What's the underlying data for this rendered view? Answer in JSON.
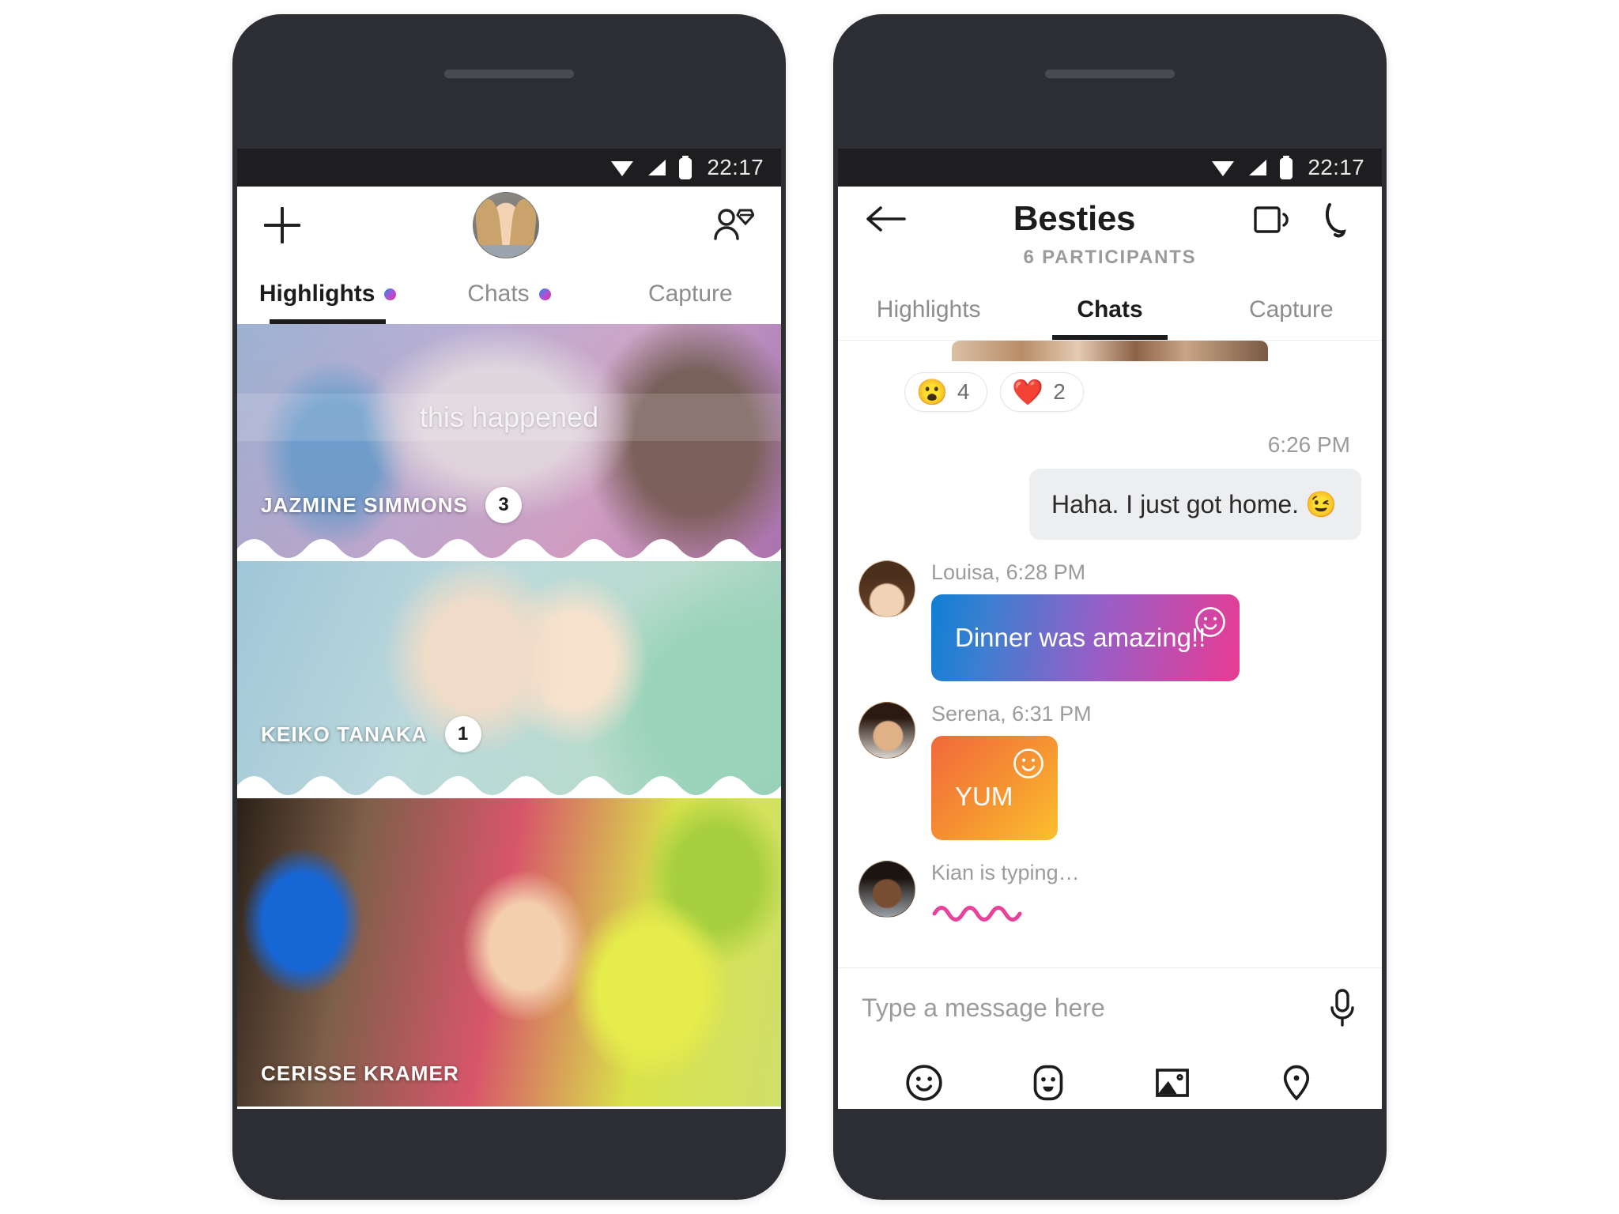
{
  "statusbar": {
    "time": "22:17",
    "icons": [
      "wifi-icon",
      "signal-icon",
      "battery-icon"
    ]
  },
  "left_phone": {
    "appbar": {
      "add_icon": "plus-icon",
      "avatar": "user-avatar",
      "add_friend_icon": "add-friend-icon"
    },
    "tabs": [
      {
        "label": "Highlights",
        "active": true,
        "dot": true
      },
      {
        "label": "Chats",
        "active": false,
        "dot": true
      },
      {
        "label": "Capture",
        "active": false,
        "dot": false
      }
    ],
    "highlights": [
      {
        "name": "JAZMINE SIMMONS",
        "badge": "3",
        "caption": "this happened"
      },
      {
        "name": "KEIKO TANAKA",
        "badge": "1",
        "caption": ""
      },
      {
        "name": "CERISSE KRAMER",
        "badge": "",
        "caption": ""
      }
    ]
  },
  "right_phone": {
    "appbar": {
      "back_icon": "back-arrow-icon",
      "title": "Besties",
      "subtitle": "6 PARTICIPANTS",
      "video_call_icon": "video-call-icon",
      "audio_call_icon": "phone-call-icon"
    },
    "tabs": [
      {
        "label": "Highlights",
        "active": false
      },
      {
        "label": "Chats",
        "active": true
      },
      {
        "label": "Capture",
        "active": false
      }
    ],
    "reactions": [
      {
        "emoji": "😮",
        "name": "surprised-emoji",
        "count": "4"
      },
      {
        "emoji": "❤️",
        "name": "heart-emoji",
        "count": "2"
      }
    ],
    "messages": [
      {
        "kind": "outgoing",
        "time": "6:26 PM",
        "text": "Haha. I just got home.",
        "emoji": "😉"
      },
      {
        "kind": "incoming",
        "meta": "Louisa, 6:28 PM",
        "sender": "Louisa",
        "text": "Dinner was amazing!!"
      },
      {
        "kind": "incoming",
        "meta": "Serena, 6:31 PM",
        "sender": "Serena",
        "text": "YUM"
      }
    ],
    "typing": {
      "text": "Kian is typing…",
      "sender": "Kian"
    },
    "composer": {
      "placeholder": "Type a message here",
      "value": "",
      "mic_icon": "microphone-icon",
      "tools": [
        {
          "name": "emoji-icon"
        },
        {
          "name": "moji-face-icon"
        },
        {
          "name": "image-icon"
        },
        {
          "name": "location-pin-icon"
        }
      ]
    }
  },
  "colors": {
    "frame": "#2d2e34",
    "statusbar": "#1e1e20",
    "accent_gradient_start": "#1f8fe8",
    "accent_gradient_mid": "#a855d8",
    "accent_gradient_end": "#e4308f",
    "bubble_out_bg": "#eceef0",
    "muted_text": "#9b9b9b",
    "typing_wave": "#e8429a"
  }
}
